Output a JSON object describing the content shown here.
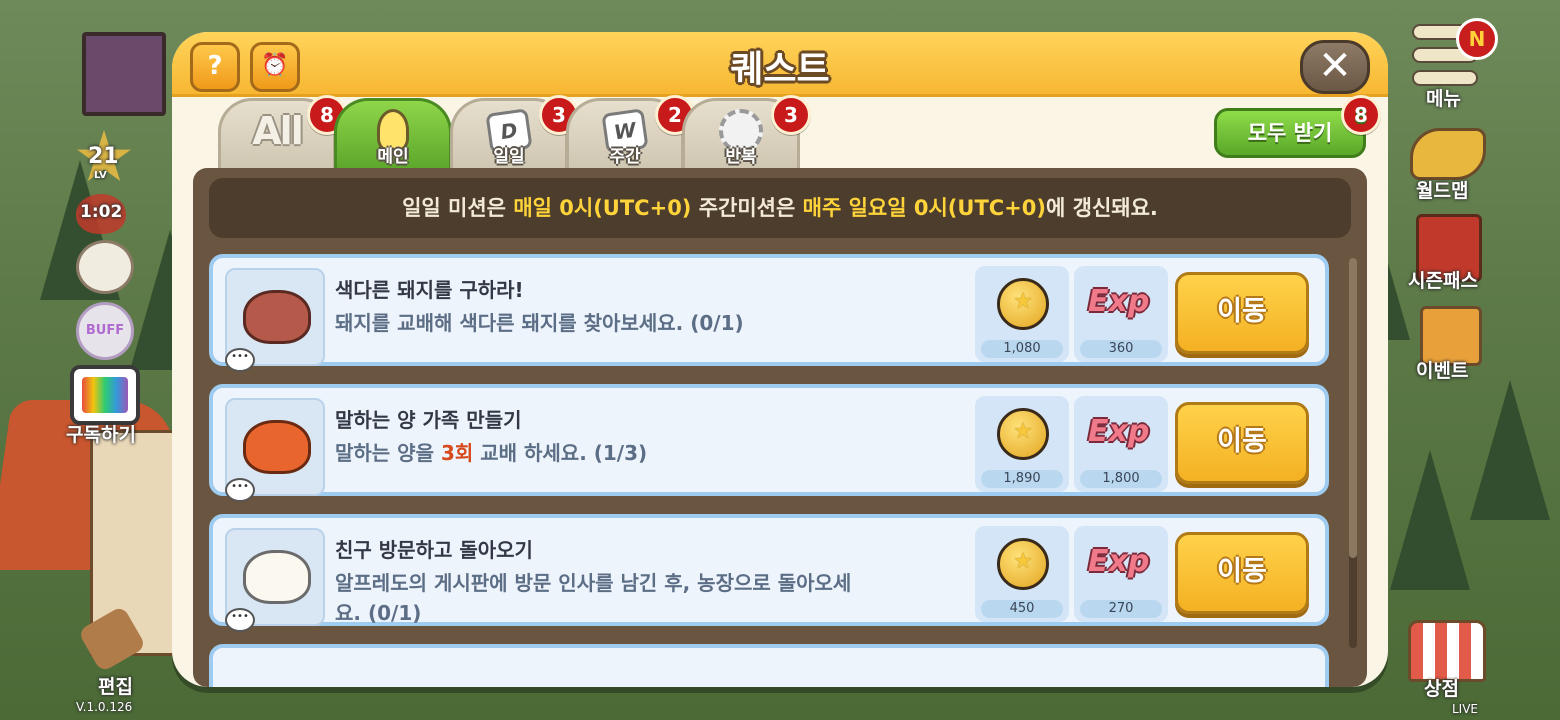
{
  "dialog": {
    "title": "퀘스트",
    "help_label": "?",
    "close_label": "✕",
    "claim_all_label": "모두 받기",
    "claim_all_badge": "8"
  },
  "tabs": [
    {
      "label": "",
      "icon_text": "All",
      "badge": "8",
      "active": false
    },
    {
      "label": "메인",
      "icon": "lightbulb-icon",
      "badge": "",
      "active": true
    },
    {
      "label": "일일",
      "icon_text": "D",
      "badge": "3",
      "active": false
    },
    {
      "label": "주간",
      "icon_text": "W",
      "badge": "2",
      "active": false
    },
    {
      "label": "반복",
      "icon": "repeat-icon",
      "badge": "3",
      "active": false
    }
  ],
  "notice": {
    "part1": "일일 미션은 ",
    "part2": "매일 0시(UTC+0)",
    "part3": " 주간미션은 ",
    "part4": "매주 일요일 0시(UTC+0)",
    "part5": "에 갱신돼요."
  },
  "quests": [
    {
      "title": "색다른 돼지를 구하라!",
      "desc": "돼지를 교배해 색다른 돼지를 찾아보세요. (0/1)",
      "coin": "1,080",
      "exp": "360",
      "button": "이동",
      "animal": "pig-icon"
    },
    {
      "title": "말하는 양 가족 만들기",
      "desc_a": "말하는 양을 ",
      "desc_b": "3회",
      "desc_c": " 교배 하세요. (1/3)",
      "coin": "1,890",
      "exp": "1,800",
      "button": "이동",
      "animal": "ram-icon"
    },
    {
      "title": "친구 방문하고 돌아오기",
      "desc": "알프레도의 게시판에 방문 인사를 남긴 후, 농장으로 돌아오세요. (0/1)",
      "coin": "450",
      "exp": "270",
      "button": "이동",
      "animal": "sheep-icon"
    }
  ],
  "reward_exp_label": "Exp",
  "hud": {
    "level": "21",
    "level_sub": "LV",
    "timer": "1:02",
    "buff": "BUFF",
    "subscribe": "구독하기",
    "edit": "편집",
    "version": "V.1.0.126",
    "menu": "메뉴",
    "menu_badge": "N",
    "world_map": "월드맵",
    "season_pass": "시즌패스",
    "event": "이벤트",
    "shop": "상점",
    "live": "LIVE"
  },
  "colors": {
    "header": "#f7b733",
    "active_tab": "#5ba52a",
    "highlight": "#ffd33a",
    "go_button": "#f4b123"
  }
}
